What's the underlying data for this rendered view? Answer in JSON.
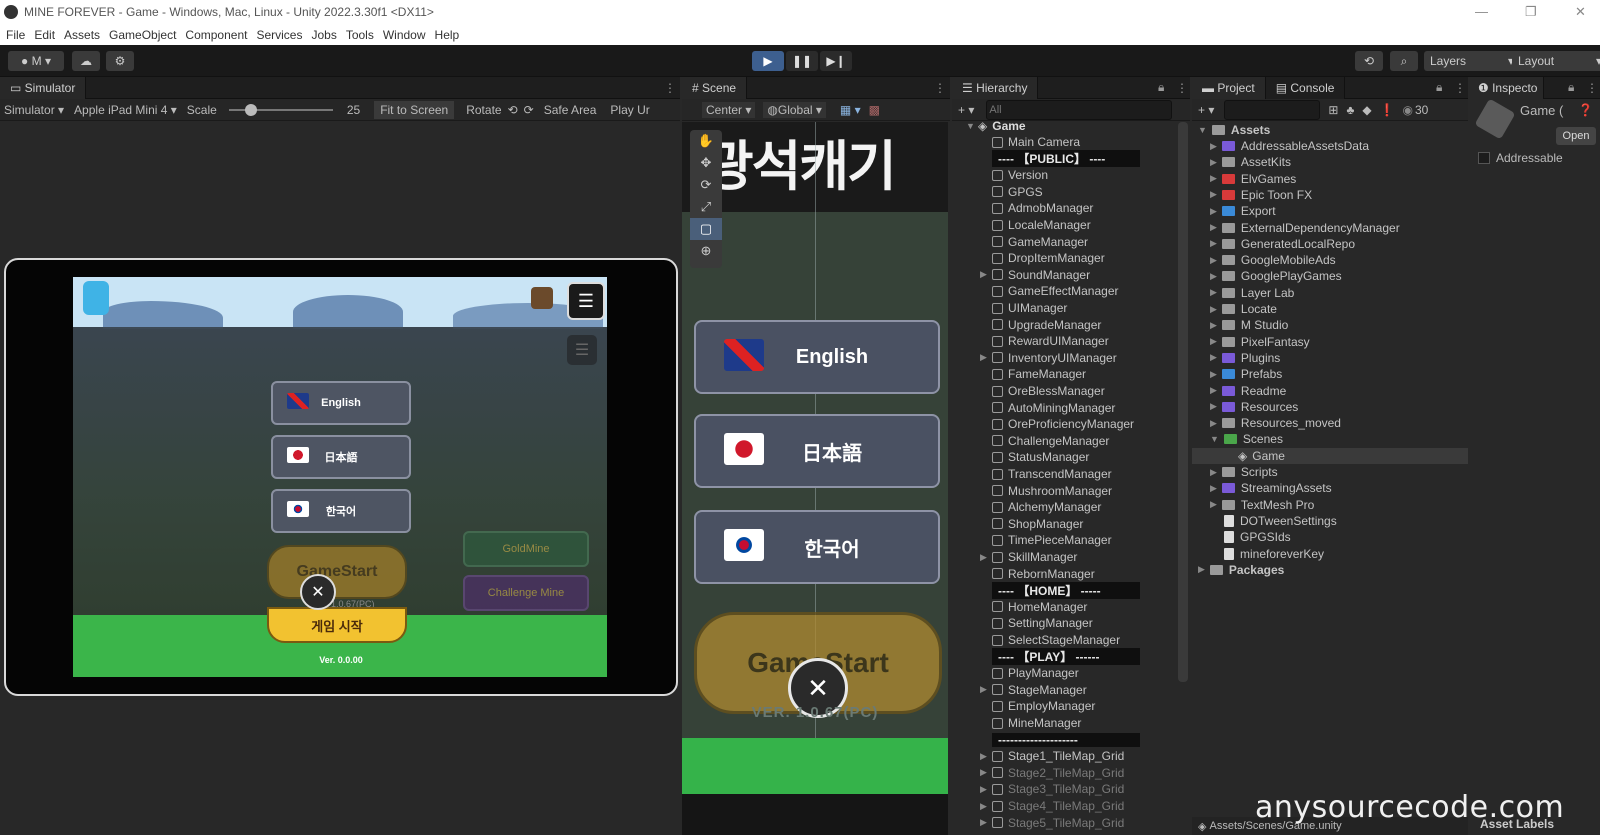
{
  "window": {
    "title": "MINE  FOREVER - Game - Windows, Mac, Linux - Unity 2022.3.30f1 <DX11>",
    "minimize": "—",
    "restore": "❐",
    "close": "✕"
  },
  "menu": [
    "File",
    "Edit",
    "Assets",
    "GameObject",
    "Component",
    "Services",
    "Jobs",
    "Tools",
    "Window",
    "Help"
  ],
  "toolbar": {
    "account": "M",
    "layers": "Layers",
    "layout": "Layout"
  },
  "simulator": {
    "tab": "Simulator",
    "mode": "Simulator",
    "device": "Apple iPad Mini 4",
    "scale_label": "Scale",
    "scale_value": "25",
    "fit": "Fit to Screen",
    "rotate": "Rotate",
    "safe_area": "Safe Area",
    "play": "Play Ur",
    "languages": [
      "English",
      "日本語",
      "한국어"
    ],
    "game_start": "GameStart",
    "start_kr": "게임 시작",
    "version_pc": "VER. 1.0.67(PC)",
    "version": "Ver. 0.0.00",
    "side_buttons": [
      "GoldMine",
      "Challenge Mine"
    ]
  },
  "scene": {
    "tab": "Scene",
    "pivot": "Center",
    "space": "Global",
    "title_text": "광석캐기",
    "languages": [
      "English",
      "日本語",
      "한국어"
    ],
    "game_start": "GameStart",
    "version": "VER. 1.0.67(PC)"
  },
  "hierarchy": {
    "tab": "Hierarchy",
    "search_placeholder": "All",
    "root": "Game",
    "items": [
      "Main Camera",
      "---- 【PUBLIC】 ----",
      "Version",
      "GPGS",
      "AdmobManager",
      "LocaleManager",
      "GameManager",
      "DropItemManager",
      "SoundManager",
      "GameEffectManager",
      "UIManager",
      "UpgradeManager",
      "RewardUIManager",
      "InventoryUIManager",
      "FameManager",
      "OreBlessManager",
      "AutoMiningManager",
      "OreProficiencyManager",
      "ChallengeManager",
      "StatusManager",
      "TranscendManager",
      "MushroomManager",
      "AlchemyManager",
      "ShopManager",
      "TimePieceManager",
      "SkillManager",
      "RebornManager",
      "---- 【HOME】 -----",
      "HomeManager",
      "SettingManager",
      "SelectStageManager",
      "---- 【PLAY】 ------",
      "PlayManager",
      "StageManager",
      "EmployManager",
      "MineManager",
      "--------------------",
      "Stage1_TileMap_Grid",
      "Stage2_TileMap_Grid",
      "Stage3_TileMap_Grid",
      "Stage4_TileMap_Grid",
      "Stage5_TileMap_Grid"
    ]
  },
  "project": {
    "tab": "Project",
    "console_tab": "Console",
    "count": "30",
    "root": "Assets",
    "folders": [
      "AddressableAssetsData",
      "AssetKits",
      "ElvGames",
      "Epic Toon FX",
      "Export",
      "ExternalDependencyManager",
      "GeneratedLocalRepo",
      "GoogleMobileAds",
      "GooglePlayGames",
      "Layer Lab",
      "Locate",
      "M Studio",
      "PixelFantasy",
      "Plugins",
      "Prefabs",
      "Readme",
      "Resources",
      "Resources_moved",
      "Scenes",
      "Game",
      "Scripts",
      "StreamingAssets",
      "TextMesh Pro",
      "DOTweenSettings",
      "GPGSIds",
      "mineforeverKey",
      "Packages"
    ],
    "path": "Assets/Scenes/Game.unity"
  },
  "inspector": {
    "tab": "Inspecto",
    "object": "Game (",
    "open": "Open",
    "addressable": "Addressable",
    "asset_labels": "Asset Labels"
  },
  "watermark": "anysourcecode.com"
}
